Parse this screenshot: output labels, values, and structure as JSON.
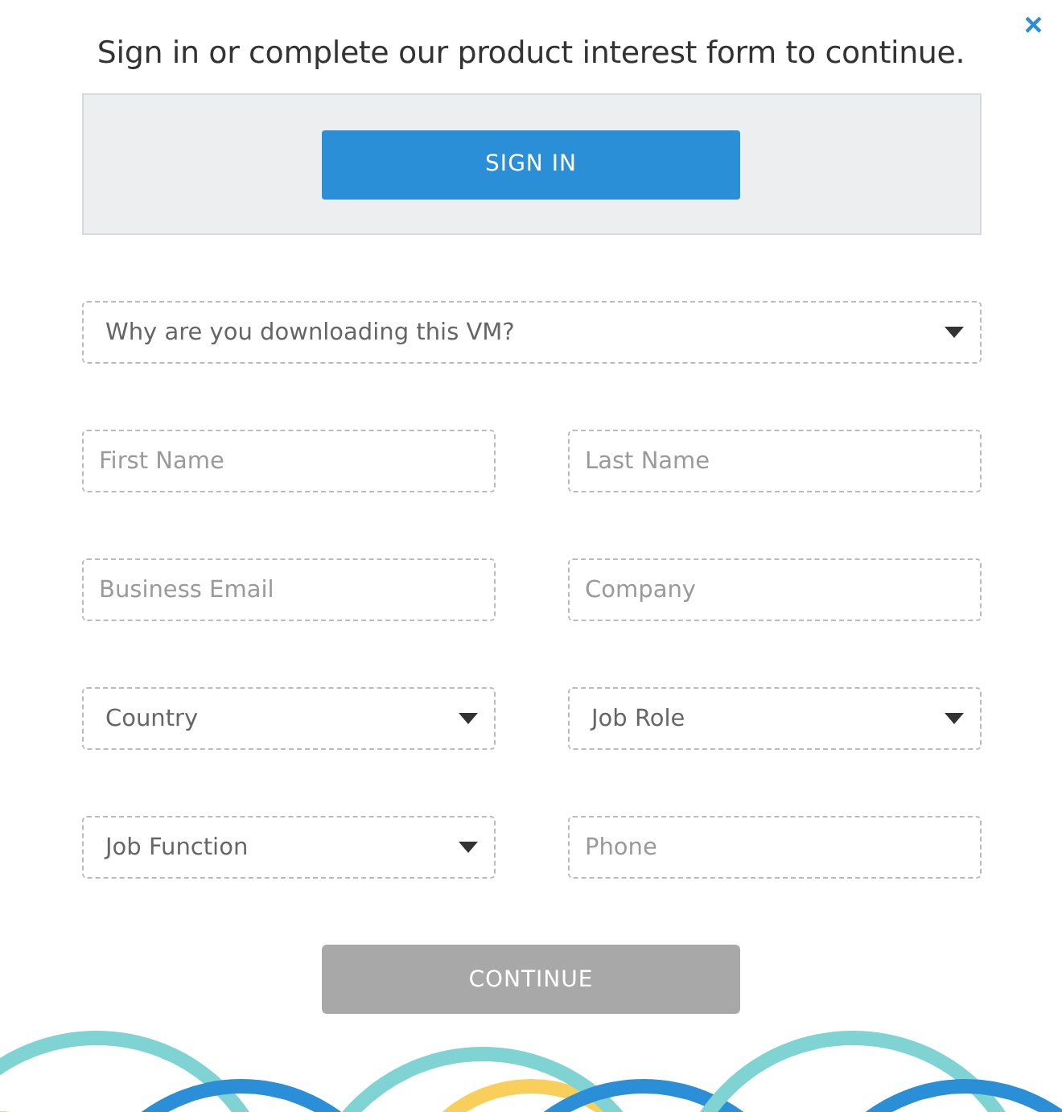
{
  "heading": "Sign in or complete our product interest form to continue.",
  "close": "×",
  "sign_in_button": "SIGN IN",
  "purpose": {
    "kind": "select",
    "placeholder": "Why are you downloading this VM?"
  },
  "fields": [
    {
      "kind": "input",
      "placeholder": "First Name"
    },
    {
      "kind": "input",
      "placeholder": "Last Name"
    },
    {
      "kind": "input",
      "placeholder": "Business Email"
    },
    {
      "kind": "input",
      "placeholder": "Company"
    },
    {
      "kind": "select",
      "placeholder": "Country"
    },
    {
      "kind": "select",
      "placeholder": "Job Role"
    },
    {
      "kind": "select",
      "placeholder": "Job Function"
    },
    {
      "kind": "input",
      "placeholder": "Phone"
    }
  ],
  "continue_button": {
    "label": "CONTINUE",
    "disabled": true
  }
}
